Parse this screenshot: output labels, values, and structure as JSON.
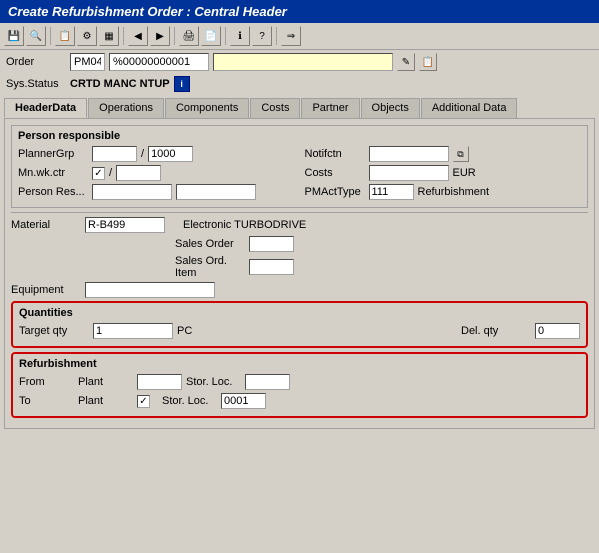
{
  "title_bar": {
    "text": "Create Refurbishment Order : Central Header"
  },
  "toolbar": {
    "buttons": [
      {
        "name": "save-icon",
        "symbol": "💾"
      },
      {
        "name": "find-icon",
        "symbol": "🔍"
      },
      {
        "name": "menu-icon",
        "symbol": "≡"
      },
      {
        "name": "settings-icon",
        "symbol": "⚙"
      },
      {
        "name": "back-icon",
        "symbol": "◀"
      },
      {
        "name": "forward-icon",
        "symbol": "▶"
      },
      {
        "name": "print-icon",
        "symbol": "🖨"
      },
      {
        "name": "new-icon",
        "symbol": "📄"
      },
      {
        "name": "help-icon",
        "symbol": "?"
      }
    ]
  },
  "order": {
    "label": "Order",
    "type": "PM04",
    "number": "%00000000001",
    "description": ""
  },
  "sys_status": {
    "label": "Sys.Status",
    "value": "CRTD  MANC  NTUP"
  },
  "tabs": [
    {
      "id": "header-data",
      "label": "HeaderData",
      "active": true
    },
    {
      "id": "operations",
      "label": "Operations",
      "active": false
    },
    {
      "id": "components",
      "label": "Components",
      "active": false
    },
    {
      "id": "costs",
      "label": "Costs",
      "active": false
    },
    {
      "id": "partner",
      "label": "Partner",
      "active": false
    },
    {
      "id": "objects",
      "label": "Objects",
      "active": false
    },
    {
      "id": "additional-data",
      "label": "Additional Data",
      "active": false
    }
  ],
  "person_responsible": {
    "section_title": "Person responsible",
    "planner_grp": {
      "label": "PlannerGrp",
      "value": "",
      "separator": "/",
      "value2": "1000"
    },
    "mn_wk_ctr": {
      "label": "Mn.wk.ctr",
      "checked": true,
      "separator": "/",
      "value2": ""
    },
    "person_res": {
      "label": "Person Res...",
      "value1": "",
      "value2": ""
    },
    "notifctn": {
      "label": "Notifctn",
      "value": ""
    },
    "costs": {
      "label": "Costs",
      "value": "",
      "unit": "EUR"
    },
    "pmact_type": {
      "label": "PMActType",
      "value": "111",
      "description": "Refurbishment"
    }
  },
  "material": {
    "label": "Material",
    "value": "R-B499",
    "description": "Electronic TURBODRIVE",
    "sales_order_label": "Sales Order",
    "sales_order_value": "",
    "sales_ord_item_label": "Sales Ord. Item",
    "sales_ord_item_value": ""
  },
  "equipment": {
    "label": "Equipment",
    "value": ""
  },
  "quantities": {
    "section_title": "Quantities",
    "target_qty": {
      "label": "Target qty",
      "value": "1",
      "unit": "PC"
    },
    "del_qty": {
      "label": "Del. qty",
      "value": "0"
    }
  },
  "refurbishment": {
    "section_title": "Refurbishment",
    "from_plant": {
      "label": "From",
      "sub_label": "Plant",
      "value": "",
      "stor_loc_label": "Stor. Loc.",
      "stor_loc_value": ""
    },
    "to_plant": {
      "label": "To",
      "sub_label": "Plant",
      "checked": true,
      "stor_loc_label": "Stor. Loc.",
      "stor_loc_value": "0001"
    }
  }
}
